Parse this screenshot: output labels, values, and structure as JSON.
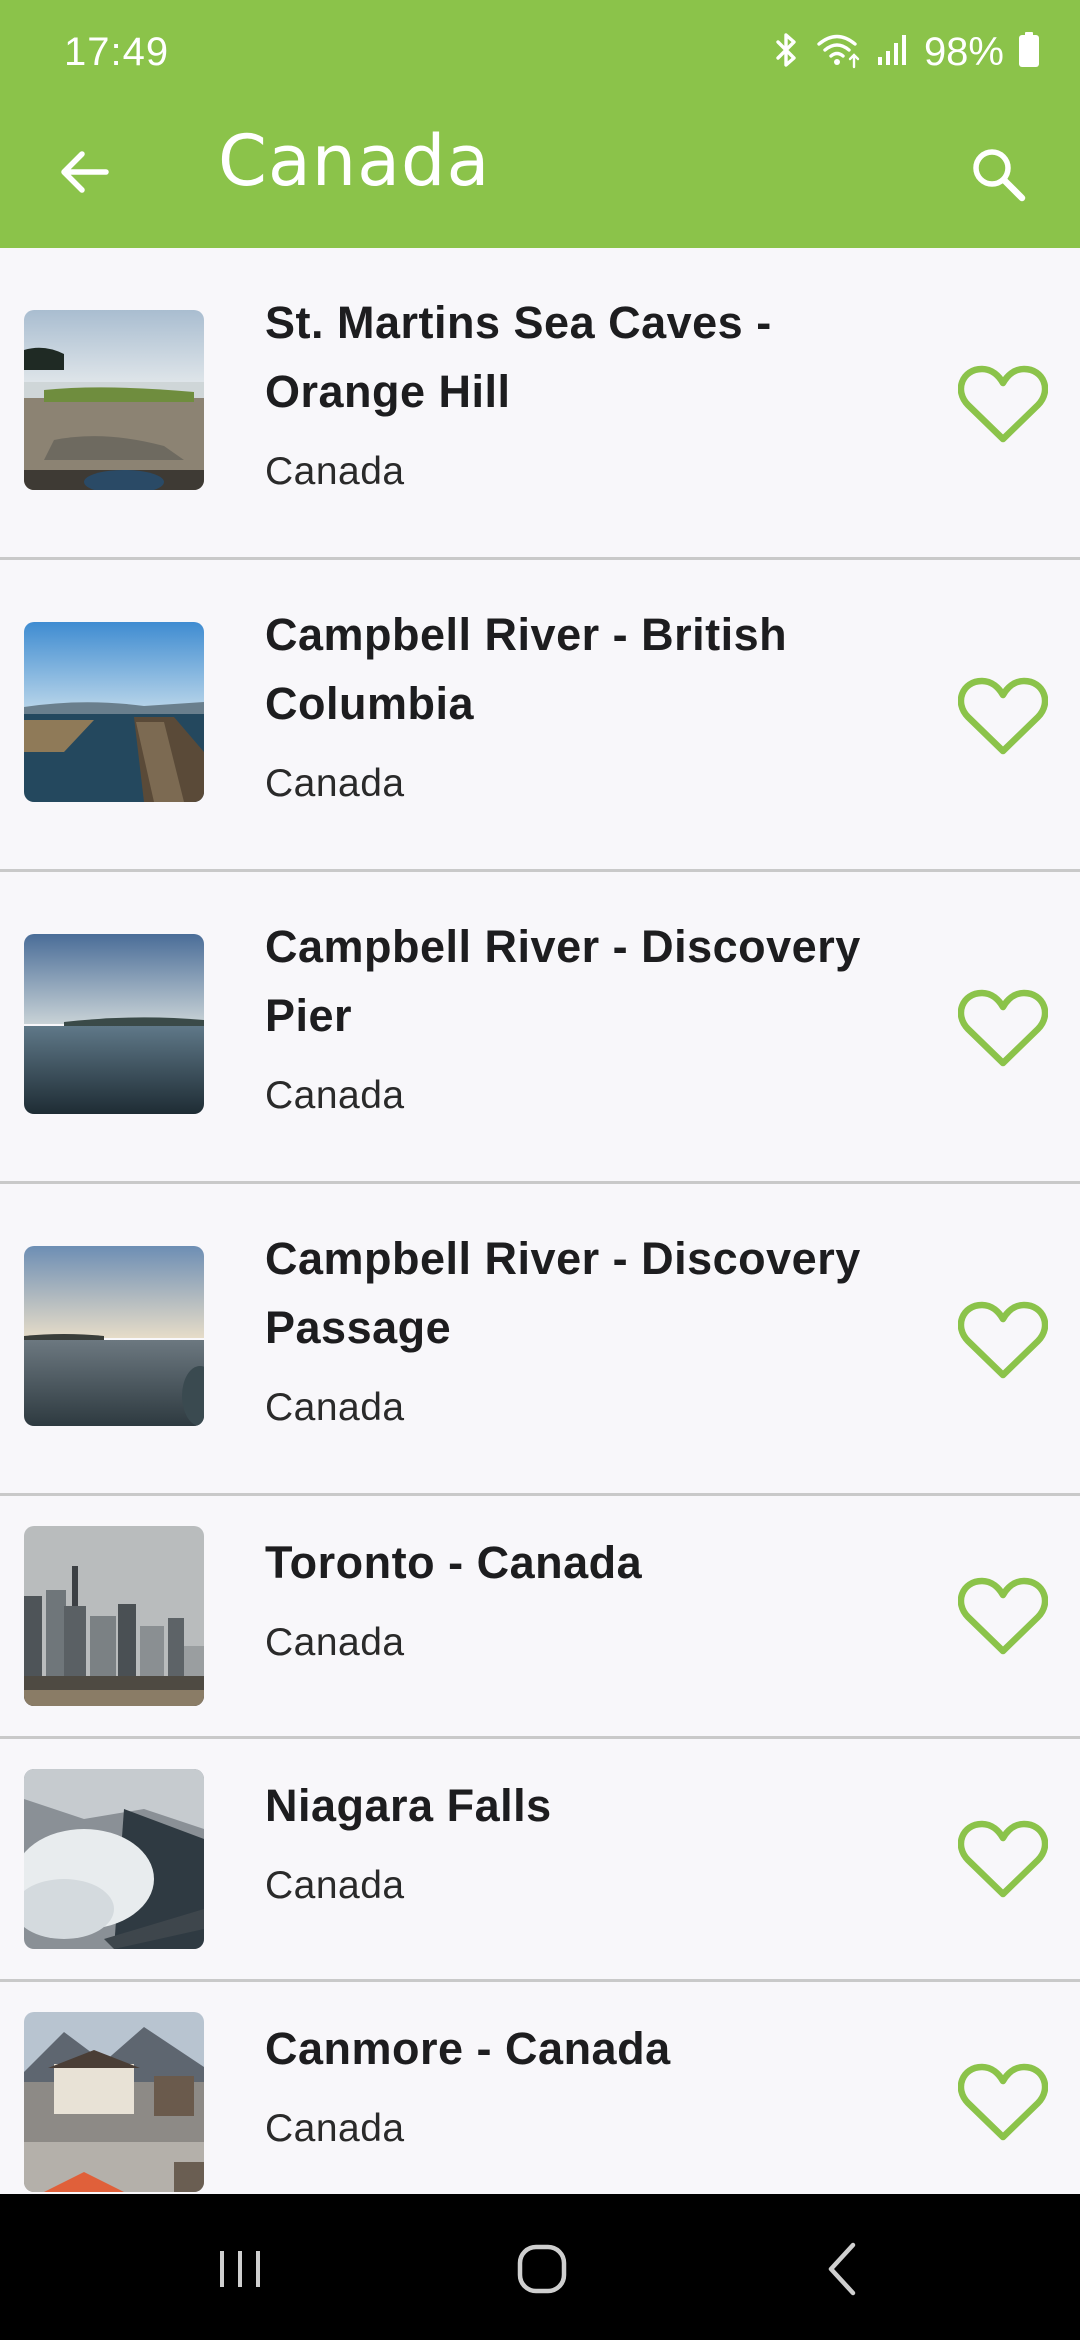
{
  "status_bar": {
    "time": "17:49",
    "battery": "98%"
  },
  "toolbar": {
    "title": "Canada",
    "back_icon": "arrow-back-icon",
    "search_icon": "search-icon"
  },
  "colors": {
    "accent": "#8bc34a",
    "heart": "#8bc34a",
    "background": "#f8f7fa",
    "divider": "#c9c9c9"
  },
  "webcams": [
    {
      "name": "St. Martins Sea Caves - Orange Hill",
      "country": "Canada",
      "favorite_icon": "heart-outline-icon"
    },
    {
      "name": "Campbell River - British Columbia",
      "country": "Canada",
      "favorite_icon": "heart-outline-icon"
    },
    {
      "name": "Campbell River - Discovery Pier",
      "country": "Canada",
      "favorite_icon": "heart-outline-icon"
    },
    {
      "name": "Campbell River - Discovery Passage",
      "country": "Canada",
      "favorite_icon": "heart-outline-icon"
    },
    {
      "name": "Toronto - Canada",
      "country": "Canada",
      "favorite_icon": "heart-outline-icon"
    },
    {
      "name": "Niagara Falls",
      "country": "Canada",
      "favorite_icon": "heart-outline-icon"
    },
    {
      "name": "Canmore - Canada",
      "country": "Canada",
      "favorite_icon": "heart-outline-icon"
    }
  ],
  "nav_bar": {
    "recents_icon": "recents-icon",
    "home_icon": "home-icon",
    "back_icon": "back-chevron-icon"
  }
}
